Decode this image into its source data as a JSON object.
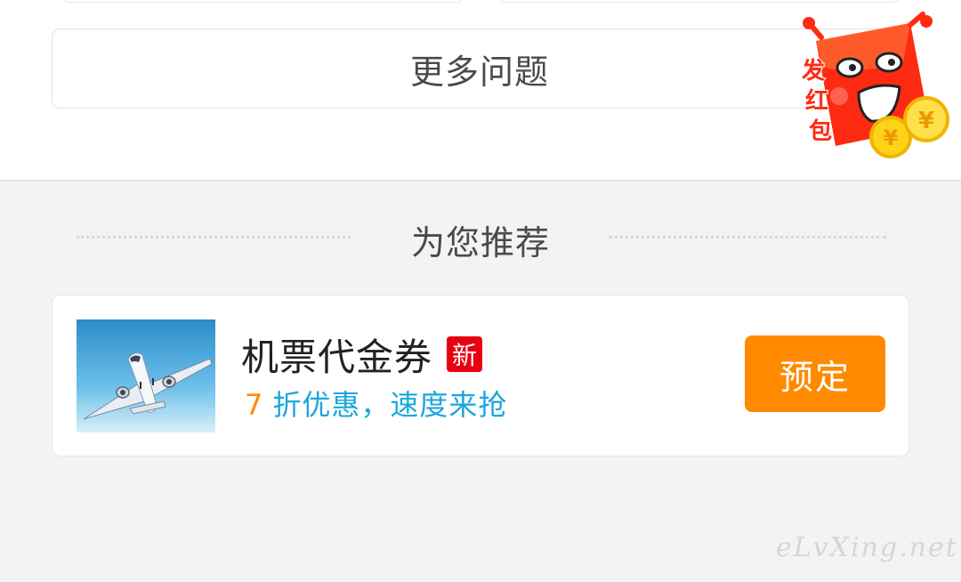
{
  "more": {
    "label": "更多问题"
  },
  "promo": {
    "icon": "red-envelope-icon",
    "label": "发红包"
  },
  "recommend": {
    "title": "为您推荐"
  },
  "item": {
    "image": "airplane-image",
    "title": "机票代金券",
    "badge": "新",
    "discount_number": "7",
    "discount_text": "折优惠，速度来抢",
    "button_label": "预定"
  },
  "watermark": {
    "text": "eLvXing.net"
  },
  "colors": {
    "accent_orange": "#ff8a00",
    "badge_red": "#e60012",
    "link_blue": "#1aa7dc",
    "page_bg": "#f3f3f3"
  }
}
